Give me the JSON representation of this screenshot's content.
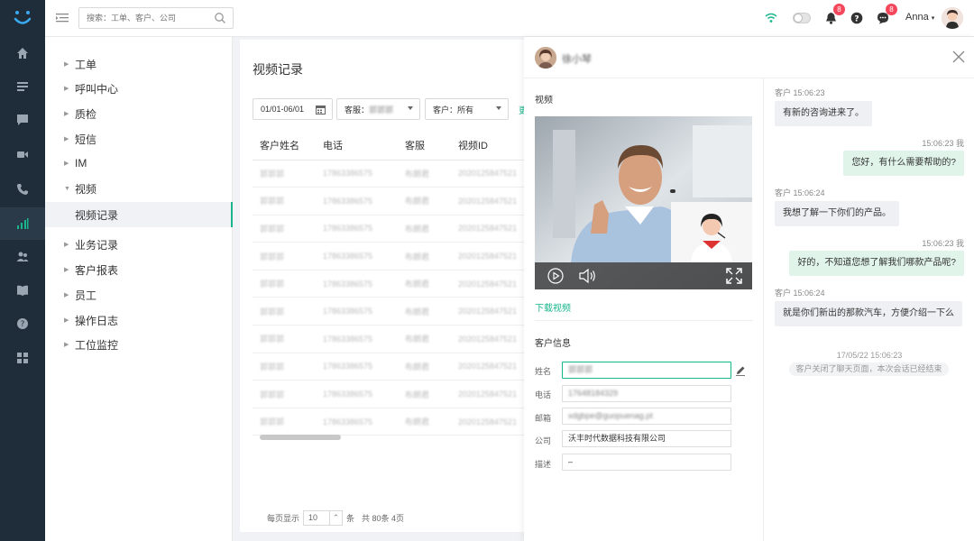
{
  "topbar": {
    "search_placeholder": "搜索：工单、客户、公司",
    "notification_count": "8",
    "message_count": "8",
    "username": "Anna",
    "accent_color": "#19b68e"
  },
  "sidebar_rail": {
    "icons": [
      "home-icon",
      "list-icon",
      "chat-icon",
      "video-icon",
      "phone-icon",
      "chart-icon",
      "users-icon",
      "book-icon",
      "help-icon",
      "grid-icon"
    ],
    "active": "chart-icon"
  },
  "sidenav": {
    "items": [
      {
        "label": "工单",
        "expanded": false
      },
      {
        "label": "呼叫中心",
        "expanded": false
      },
      {
        "label": "质检",
        "expanded": false
      },
      {
        "label": "短信",
        "expanded": false
      },
      {
        "label": "IM",
        "expanded": false
      },
      {
        "label": "视频",
        "expanded": true
      },
      {
        "label": "视频记录",
        "sub": true,
        "selected": true
      },
      {
        "label": "业务记录",
        "expanded": false
      },
      {
        "label": "客户报表",
        "expanded": false
      },
      {
        "label": "员工",
        "expanded": false
      },
      {
        "label": "操作日志",
        "expanded": false
      },
      {
        "label": "工位监控",
        "expanded": false
      }
    ]
  },
  "main": {
    "title": "视频记录",
    "filters": {
      "date_range": "01/01-06/01",
      "agent_label": "客服：",
      "agent_value": "郭郭郭",
      "customer": "客户：所有",
      "more": "更"
    },
    "table": {
      "columns": [
        "客户姓名",
        "电话",
        "客服",
        "视频ID"
      ],
      "rows": [
        [
          "郭郭郭",
          "17863386575",
          "布朗君",
          "2020125847521"
        ],
        [
          "郭郭郭",
          "17863386575",
          "布朗君",
          "2020125847521"
        ],
        [
          "郭郭郭",
          "17863386575",
          "布朗君",
          "2020125847521"
        ],
        [
          "郭郭郭",
          "17863386575",
          "布朗君",
          "2020125847521"
        ],
        [
          "郭郭郭",
          "17863386575",
          "布朗君",
          "2020125847521"
        ],
        [
          "郭郭郭",
          "17863386575",
          "布朗君",
          "2020125847521"
        ],
        [
          "郭郭郭",
          "17863386575",
          "布朗君",
          "2020125847521"
        ],
        [
          "郭郭郭",
          "17863386575",
          "布朗君",
          "2020125847521"
        ],
        [
          "郭郭郭",
          "17863386575",
          "布朗君",
          "2020125847521"
        ],
        [
          "郭郭郭",
          "17863386575",
          "布朗君",
          "2020125847521"
        ]
      ]
    },
    "pager": {
      "per_page_label": "每页显示",
      "per_page": "10",
      "unit": "条",
      "total": "共  80条  4页"
    }
  },
  "drawer": {
    "customer_name": "徐小琴",
    "video_section": "视频",
    "download": "下载视频",
    "info_section": "客户信息",
    "fields": [
      {
        "label": "姓名",
        "value": "郭郭郭"
      },
      {
        "label": "电话",
        "value": "17648184329"
      },
      {
        "label": "邮箱",
        "value": "xdgbpe@guopuenag.pt"
      },
      {
        "label": "公司",
        "value": "沃丰时代数据科技有限公司"
      },
      {
        "label": "描述",
        "value": "–"
      }
    ],
    "chat": [
      {
        "dir": "in",
        "sender": "客户",
        "time": "15:06:23",
        "text": "有新的咨询进来了。"
      },
      {
        "dir": "out",
        "sender": "我",
        "time": "15:06:23",
        "text": "您好，有什么需要帮助的?"
      },
      {
        "dir": "in",
        "sender": "客户",
        "time": "15:06:24",
        "text": "我想了解一下你们的产品。"
      },
      {
        "dir": "out",
        "sender": "我",
        "time": "15:06:23",
        "text": "好的，不知道您想了解我们哪款产品呢?"
      },
      {
        "dir": "in",
        "sender": "客户",
        "time": "15:06:24",
        "text": "就是你们新出的那款汽车，方便介绍一下么"
      }
    ],
    "system_date": "17/05/22 15:06:23",
    "system_message": "客户关闭了聊天页面，本次会话已经结束"
  }
}
